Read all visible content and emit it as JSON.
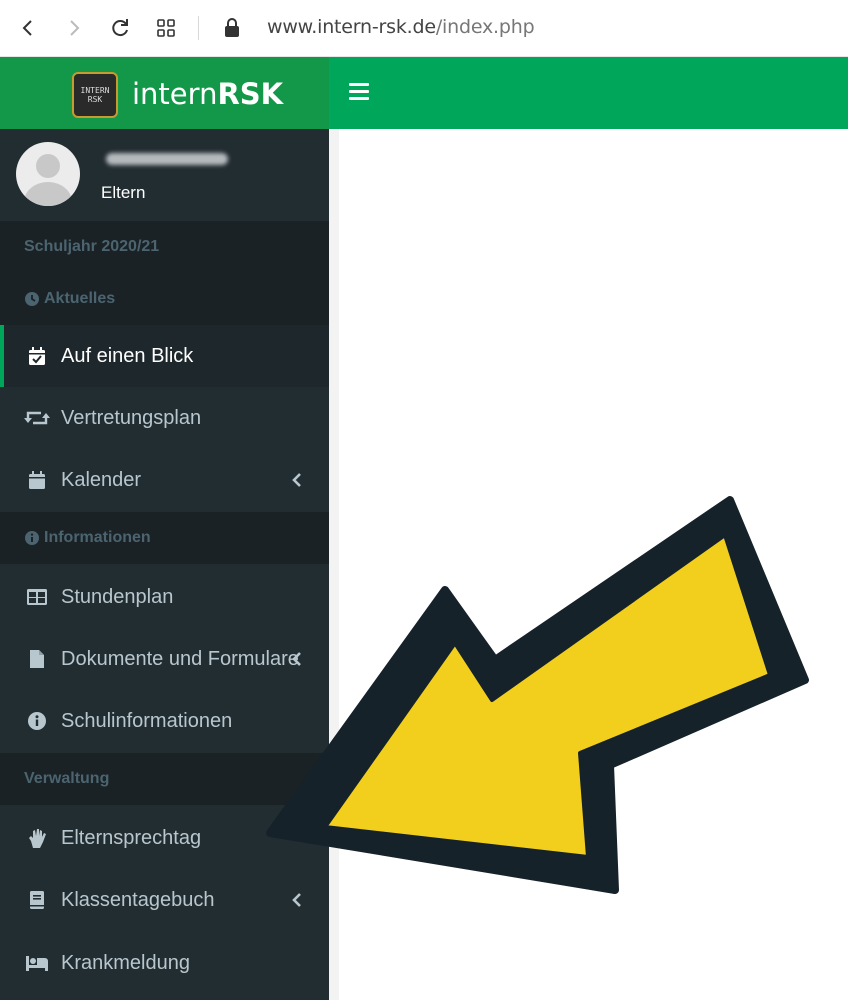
{
  "browser": {
    "url_domain": "www.intern-rsk.de",
    "url_path": "/index.php"
  },
  "brand": {
    "logo_text_line1": "INTERN",
    "logo_text_line2": "RSK",
    "name_light": "intern",
    "name_bold": "RSK",
    "primary_color": "#00a65a",
    "brand_bar_color": "#129848"
  },
  "user": {
    "role": "Eltern"
  },
  "sidebar": {
    "school_year": "Schuljahr 2020/21",
    "sections": {
      "aktuelles": "Aktuelles",
      "informationen": "Informationen",
      "verwaltung": "Verwaltung"
    },
    "items": [
      {
        "label": "Auf einen Blick",
        "icon": "calendar-check-icon"
      },
      {
        "label": "Vertretungsplan",
        "icon": "retweet-icon"
      },
      {
        "label": "Kalender",
        "icon": "calendar-icon"
      },
      {
        "label": "Stundenplan",
        "icon": "table-icon"
      },
      {
        "label": "Dokumente und Formulare",
        "icon": "file-icon"
      },
      {
        "label": "Schulinformationen",
        "icon": "info-circle-icon"
      },
      {
        "label": "Elternsprechtag",
        "icon": "handshake-icon"
      },
      {
        "label": "Klassentagebuch",
        "icon": "book-icon"
      },
      {
        "label": "Krankmeldung",
        "icon": "bed-icon"
      }
    ],
    "background_color": "#222d32",
    "text_color": "#b8c7ce"
  },
  "annotation": {
    "arrow_color": "#f2cf1d",
    "arrow_outline_color": "#16222a"
  }
}
